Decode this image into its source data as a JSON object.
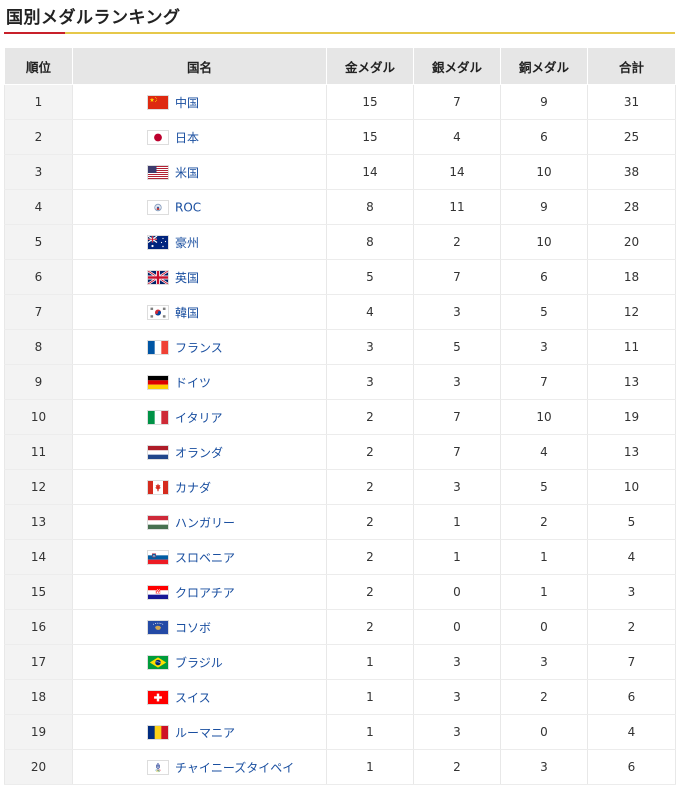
{
  "page_title": "国別メダルランキング",
  "headers": [
    "順位",
    "国名",
    "金メダル",
    "銀メダル",
    "銅メダル",
    "合計"
  ],
  "rows": [
    {
      "rank": "1",
      "country": "中国",
      "flag": "china-flag-icon",
      "gold": "15",
      "silver": "7",
      "bronze": "9",
      "total": "31"
    },
    {
      "rank": "2",
      "country": "日本",
      "flag": "japan-flag-icon",
      "gold": "15",
      "silver": "4",
      "bronze": "6",
      "total": "25"
    },
    {
      "rank": "3",
      "country": "米国",
      "flag": "usa-flag-icon",
      "gold": "14",
      "silver": "14",
      "bronze": "10",
      "total": "38"
    },
    {
      "rank": "4",
      "country": "ROC",
      "flag": "roc-flag-icon",
      "gold": "8",
      "silver": "11",
      "bronze": "9",
      "total": "28"
    },
    {
      "rank": "5",
      "country": "豪州",
      "flag": "australia-flag-icon",
      "gold": "8",
      "silver": "2",
      "bronze": "10",
      "total": "20"
    },
    {
      "rank": "6",
      "country": "英国",
      "flag": "uk-flag-icon",
      "gold": "5",
      "silver": "7",
      "bronze": "6",
      "total": "18"
    },
    {
      "rank": "7",
      "country": "韓国",
      "flag": "korea-flag-icon",
      "gold": "4",
      "silver": "3",
      "bronze": "5",
      "total": "12"
    },
    {
      "rank": "8",
      "country": "フランス",
      "flag": "france-flag-icon",
      "gold": "3",
      "silver": "5",
      "bronze": "3",
      "total": "11"
    },
    {
      "rank": "9",
      "country": "ドイツ",
      "flag": "germany-flag-icon",
      "gold": "3",
      "silver": "3",
      "bronze": "7",
      "total": "13"
    },
    {
      "rank": "10",
      "country": "イタリア",
      "flag": "italy-flag-icon",
      "gold": "2",
      "silver": "7",
      "bronze": "10",
      "total": "19"
    },
    {
      "rank": "11",
      "country": "オランダ",
      "flag": "netherlands-flag-icon",
      "gold": "2",
      "silver": "7",
      "bronze": "4",
      "total": "13"
    },
    {
      "rank": "12",
      "country": "カナダ",
      "flag": "canada-flag-icon",
      "gold": "2",
      "silver": "3",
      "bronze": "5",
      "total": "10"
    },
    {
      "rank": "13",
      "country": "ハンガリー",
      "flag": "hungary-flag-icon",
      "gold": "2",
      "silver": "1",
      "bronze": "2",
      "total": "5"
    },
    {
      "rank": "14",
      "country": "スロベニア",
      "flag": "slovenia-flag-icon",
      "gold": "2",
      "silver": "1",
      "bronze": "1",
      "total": "4"
    },
    {
      "rank": "15",
      "country": "クロアチア",
      "flag": "croatia-flag-icon",
      "gold": "2",
      "silver": "0",
      "bronze": "1",
      "total": "3"
    },
    {
      "rank": "16",
      "country": "コソボ",
      "flag": "kosovo-flag-icon",
      "gold": "2",
      "silver": "0",
      "bronze": "0",
      "total": "2"
    },
    {
      "rank": "17",
      "country": "ブラジル",
      "flag": "brazil-flag-icon",
      "gold": "1",
      "silver": "3",
      "bronze": "3",
      "total": "7"
    },
    {
      "rank": "18",
      "country": "スイス",
      "flag": "switzerland-flag-icon",
      "gold": "1",
      "silver": "3",
      "bronze": "2",
      "total": "6"
    },
    {
      "rank": "19",
      "country": "ルーマニア",
      "flag": "romania-flag-icon",
      "gold": "1",
      "silver": "3",
      "bronze": "0",
      "total": "4"
    },
    {
      "rank": "20",
      "country": "チャイニーズタイペイ",
      "flag": "chinese-taipei-flag-icon",
      "gold": "1",
      "silver": "2",
      "bronze": "3",
      "total": "6"
    }
  ],
  "colors": {
    "header_bg": "#e6e6e6",
    "rank_bg": "#f3f3f3",
    "link": "#1a4fa0",
    "title_underline": "#e6c84a",
    "title_accent": "#c8202a"
  }
}
